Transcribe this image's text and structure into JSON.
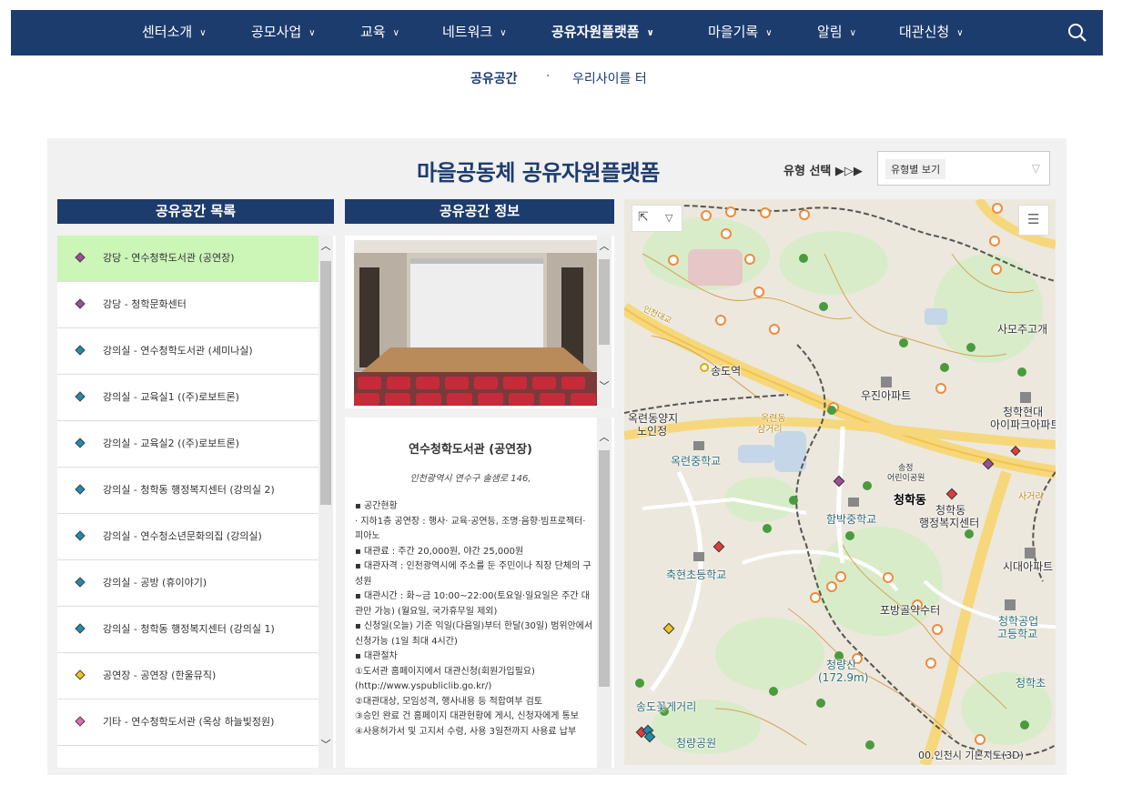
{
  "nav": {
    "items": [
      {
        "label": "센터소개"
      },
      {
        "label": "공모사업"
      },
      {
        "label": "교육"
      },
      {
        "label": "네트워크"
      },
      {
        "label": "공유자원플랫폼"
      },
      {
        "label": "마을기록"
      },
      {
        "label": "알림"
      },
      {
        "label": "대관신청"
      }
    ],
    "active_index": 4,
    "search_icon": "search-icon"
  },
  "breadcrumb": {
    "current": "공유공간",
    "separator": "·",
    "next": "우리사이를 터"
  },
  "panel": {
    "title": "마을공동체 공유자원플랫폼",
    "type_select_label": "유형 선택 ▶▷▶",
    "type_select_value": "유형별 보기"
  },
  "list": {
    "header": "공유공간 목록",
    "items": [
      {
        "label": "강당 - 연수청학도서관 (공연장)",
        "color": "#9b4f96",
        "selected": true
      },
      {
        "label": "강당 - 청학문화센터",
        "color": "#9b4f96"
      },
      {
        "label": "강의실 - 연수청학도서관 (세미나실)",
        "color": "#1f8ca8"
      },
      {
        "label": "강의실 - 교육실1 ((주)로보트론)",
        "color": "#1f8ca8"
      },
      {
        "label": "강의실 - 교육실2 ((주)로보트론)",
        "color": "#1f8ca8"
      },
      {
        "label": "강의실 - 청학동 행정복지센터 (강의실 2)",
        "color": "#1f8ca8"
      },
      {
        "label": "강의실 -  연수청소년문화의집 (강의실)",
        "color": "#1f8ca8"
      },
      {
        "label": "강의실 - 공방 (휴이야기)",
        "color": "#1f8ca8"
      },
      {
        "label": "강의실 - 청학동 행정복지센터 (강의실 1)",
        "color": "#1f8ca8"
      },
      {
        "label": "공연장 - 공연장 (한울뮤직)",
        "color": "#f2c31c"
      },
      {
        "label": "기타 - 연수청학도서관 (옥상 하늘빛정원)",
        "color": "#e26ab0"
      }
    ]
  },
  "info": {
    "header": "공유공간 정보",
    "name": "연수청학도서관 (공연장)",
    "address": "인천광역시 연수구 솔샘로 146,",
    "lines": [
      "▪ 공간현황",
      "· 지하1층 공연장 : 행사· 교육·공연등, 조명·음향·빔프로젝터·피아노",
      "▪ 대관료 : 주간 20,000원, 야간 25,000원",
      "▪ 대관자격 : 인천광역시에 주소를 둔 주민이나 직장 단체의 구성원",
      "▪ 대관시간 : 화~금 10:00~22:00(토요일·일요일은 주간 대관만 가능) (월요일, 국가휴무일 제외)",
      "▪ 신청일(오늘) 기준 익일(다음일)부터 한달(30일) 범위안에서 신청가능 (1일 최대 4시간)",
      "▪ 대관절차",
      "①도서관 홈페이지에서 대관신청(회원가입필요) (http://www.yspubliclib.go.kr/)",
      "②대관대상, 모임성격, 행사내용 등 적합여부 검토",
      "③승인 완료 건 홈페이지 대관현황에 게시, 신청자에게 통보",
      "④사용허가서 및 고지서 수령, 사용 3일전까지 사용료 납부"
    ]
  },
  "map": {
    "labels": {
      "songdo_station": "송도역",
      "ujin_apt": "우진아파트",
      "samo": "사모주고개",
      "cheonghak_hyundai1": "청학현대",
      "cheonghak_hyundai2": "아이파크아파트",
      "okryeon_center1": "옥련동양지",
      "okryeon_center2": "노인정",
      "okryeon_middle": "옥련중학교",
      "cheonghak_dong": "청학동",
      "admin1": "청학동",
      "admin2": "행정복지센터",
      "hambak_middle": "함박중학교",
      "chukhyeon": "축현초등학교",
      "sidae_apt": "시대아파트",
      "pobang": "포방골약수터",
      "cheonghak_tech1": "청학공업",
      "cheonghak_tech2": "고등학교",
      "cheongnyangsan1": "청량산",
      "cheongnyangsan2": "(172.9m)",
      "songdo_flower": "송도꽃게거리",
      "cheongnyang_park": "청량공원",
      "cheonghak_east": "청학초",
      "samgeori1": "옥련동",
      "samgeori2": "삼거리",
      "jeonggyo": "송정",
      "children": "어린이공원",
      "sagwi": "사거리",
      "road1": "인천대교",
      "credit": "00.인천시 기본지도(3D)"
    }
  }
}
